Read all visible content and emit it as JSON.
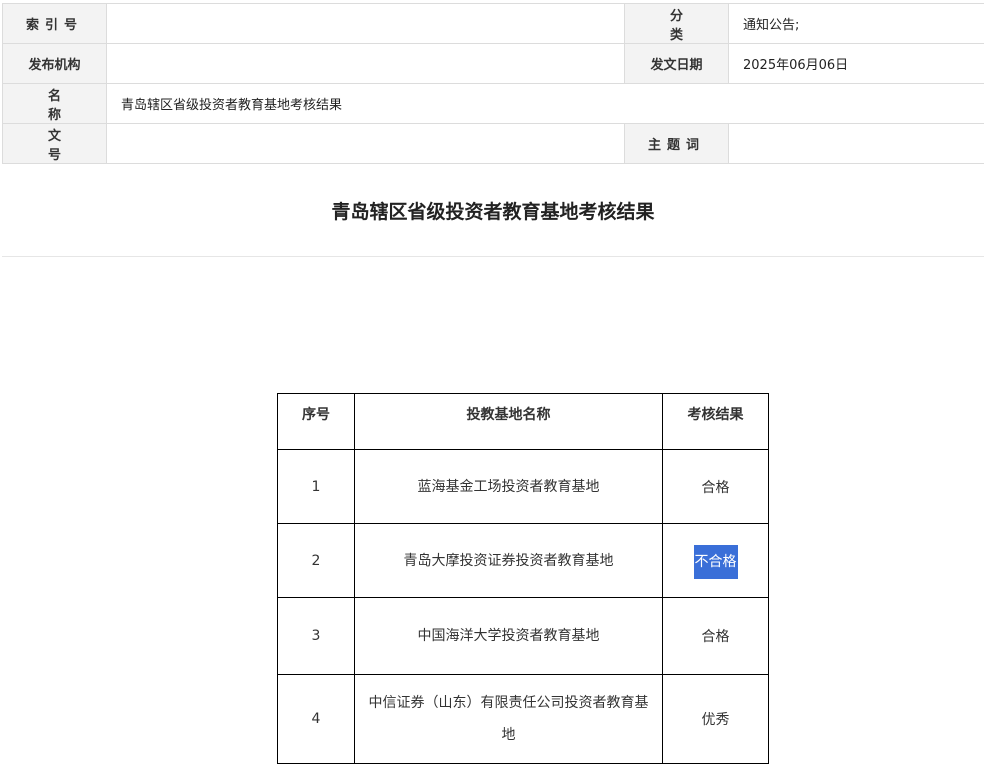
{
  "meta": {
    "index_label": "索引号",
    "index_value": "",
    "category_label": "分  类",
    "category_value": "通知公告;",
    "publisher_label": "发布机构",
    "publisher_value": "",
    "date_label": "发文日期",
    "date_value": "2025年06月06日",
    "name_label": "名  称",
    "name_value": "青岛辖区省级投资者教育基地考核结果",
    "docno_label": "文  号",
    "docno_value": "",
    "keyword_label": "主题词",
    "keyword_value": ""
  },
  "title": "青岛辖区省级投资者教育基地考核结果",
  "table": {
    "headers": [
      "序号",
      "投教基地名称",
      "考核结果"
    ],
    "rows": [
      {
        "no": "1",
        "name": "蓝海基金工场投资者教育基地",
        "result": "合格"
      },
      {
        "no": "2",
        "name": "青岛大摩投资证券投资者教育基地",
        "result": "不合格"
      },
      {
        "no": "3",
        "name": "中国海洋大学投资者教育基地",
        "result": "合格"
      },
      {
        "no": "4",
        "name": "中信证券（山东）有限责任公司投资者教育基地",
        "result": "优秀"
      }
    ]
  }
}
